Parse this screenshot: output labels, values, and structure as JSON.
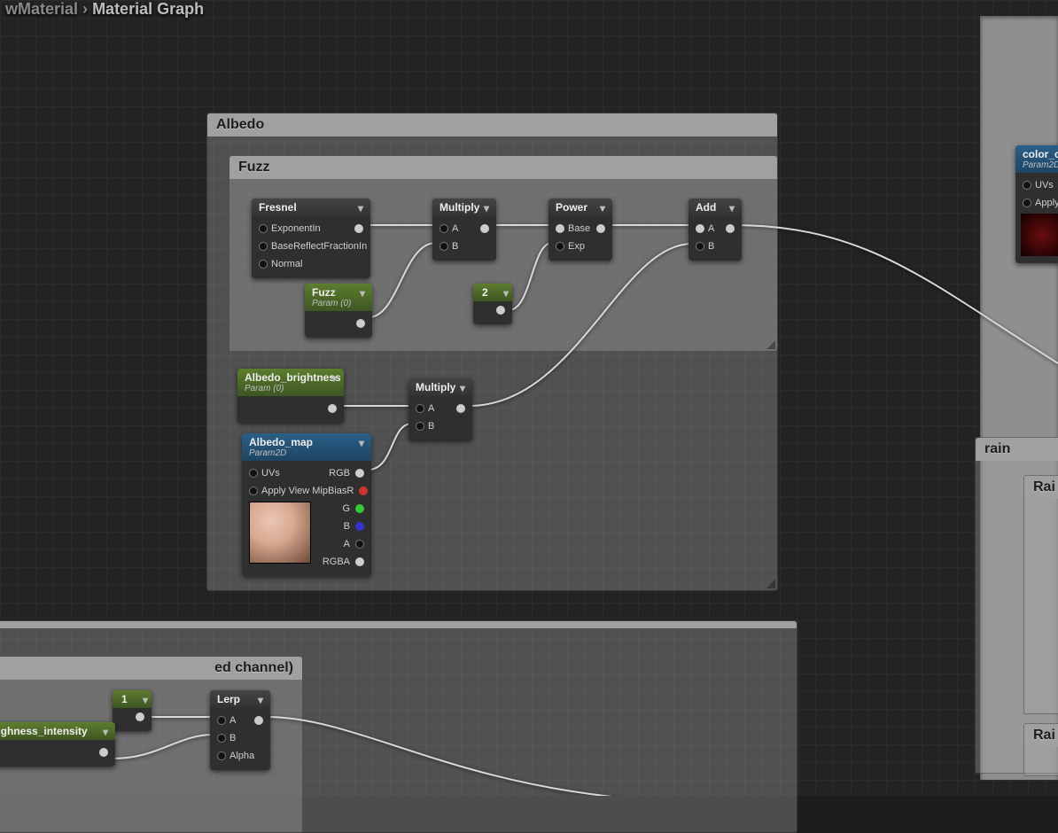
{
  "breadcrumb": {
    "prev": "wMaterial",
    "sep": "›",
    "curr": "Material Graph"
  },
  "groups": {
    "albedo": {
      "title": "Albedo"
    },
    "fuzz": {
      "title": "Fuzz"
    },
    "redch": {
      "title": "ed channel)"
    },
    "rain": {
      "title": "rain"
    },
    "rai": {
      "title": "Rai"
    }
  },
  "nodes": {
    "fresnel": {
      "title": "Fresnel",
      "ins": [
        "ExponentIn",
        "BaseReflectFractionIn",
        "Normal"
      ]
    },
    "multiply1": {
      "title": "Multiply",
      "ins": [
        "A",
        "B"
      ]
    },
    "power": {
      "title": "Power",
      "ins": [
        "Base",
        "Exp"
      ]
    },
    "add": {
      "title": "Add",
      "ins": [
        "A",
        "B"
      ]
    },
    "fuzz": {
      "title": "Fuzz",
      "sub": "Param (0)"
    },
    "const2": {
      "title": "2"
    },
    "brightness": {
      "title": "Albedo_brightness",
      "sub": "Param (0)"
    },
    "multiply2": {
      "title": "Multiply",
      "ins": [
        "A",
        "B"
      ]
    },
    "albedomap": {
      "title": "Albedo_map",
      "sub": "Param2D",
      "ins": [
        "UVs",
        "Apply View MipBias"
      ],
      "outs": [
        "RGB",
        "R",
        "G",
        "B",
        "A",
        "RGBA"
      ]
    },
    "colorch": {
      "title": "color_ch",
      "sub": "Param2D",
      "ins": [
        "UVs",
        "Apply V"
      ]
    },
    "const1": {
      "title": "1"
    },
    "lerp": {
      "title": "Lerp",
      "ins": [
        "A",
        "B",
        "Alpha"
      ]
    },
    "rough": {
      "title": "e_roughness_intensity"
    }
  }
}
